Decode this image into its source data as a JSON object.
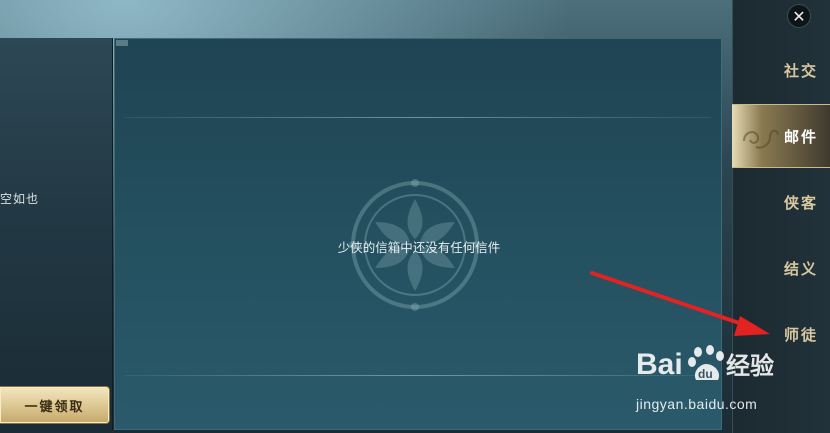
{
  "left_panel": {
    "partial_text": "空如也",
    "claim_all_button": "一键领取"
  },
  "mail_panel": {
    "empty_message": "少侠的信箱中还没有任何信件"
  },
  "sidebar": {
    "close_icon": "close-icon",
    "tabs": [
      {
        "label": "社交",
        "active": false
      },
      {
        "label": "邮件",
        "active": true
      },
      {
        "label": "侠客",
        "active": false
      },
      {
        "label": "结义",
        "active": false
      },
      {
        "label": "师徒",
        "active": false
      }
    ]
  },
  "watermark": {
    "logo_text": "Bai du 经验",
    "url": "jingyan.baidu.com"
  },
  "colors": {
    "accent_gold": "#d8c79f",
    "annotation_arrow": "#e32222"
  }
}
